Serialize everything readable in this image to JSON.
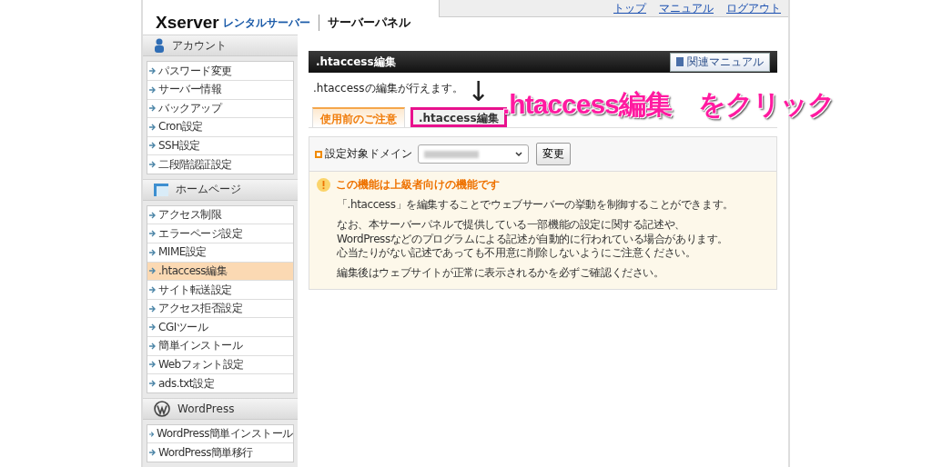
{
  "header": {
    "logo": {
      "brand": "Xserver",
      "product": "レンタルサーバー",
      "panel": "サーバーパネル"
    },
    "links": [
      "トップ",
      "マニュアル",
      "ログアウト"
    ]
  },
  "sidebar": {
    "sections": [
      {
        "title": "アカウント",
        "items": [
          {
            "label": "パスワード変更",
            "selected": false
          },
          {
            "label": "サーバー情報",
            "selected": false
          },
          {
            "label": "バックアップ",
            "selected": false
          },
          {
            "label": "Cron設定",
            "selected": false
          },
          {
            "label": "SSH設定",
            "selected": false
          },
          {
            "label": "二段階認証設定",
            "selected": false
          }
        ]
      },
      {
        "title": "ホームページ",
        "items": [
          {
            "label": "アクセス制限",
            "selected": false
          },
          {
            "label": "エラーページ設定",
            "selected": false
          },
          {
            "label": "MIME設定",
            "selected": false
          },
          {
            "label": ".htaccess編集",
            "selected": true
          },
          {
            "label": "サイト転送設定",
            "selected": false
          },
          {
            "label": "アクセス拒否設定",
            "selected": false
          },
          {
            "label": "CGIツール",
            "selected": false
          },
          {
            "label": "簡単インストール",
            "selected": false
          },
          {
            "label": "Webフォント設定",
            "selected": false
          },
          {
            "label": "ads.txt設定",
            "selected": false
          }
        ]
      },
      {
        "title": "WordPress",
        "items": [
          {
            "label": "WordPress簡単インストール",
            "selected": false
          },
          {
            "label": "WordPress簡単移行",
            "selected": false
          }
        ]
      }
    ]
  },
  "main": {
    "title": ".htaccess編集",
    "manual_button": "関連マニュアル",
    "description": ".htaccessの編集が行えます。",
    "tabs": [
      {
        "label": "使用前のご注意",
        "selected": true,
        "highlighted": false
      },
      {
        "label": ".htaccess編集",
        "selected": false,
        "highlighted": true
      }
    ],
    "domain": {
      "label": "設定対象ドメイン",
      "button": "変更"
    },
    "notice": {
      "title": "この機能は上級者向けの機能です",
      "paragraphs": [
        [
          "「.htaccess」を編集することでウェブサーバーの挙動を制御することができます。"
        ],
        [
          "なお、本サーバーパネルで提供している一部機能の設定に関する記述や、",
          "WordPressなどのプログラムによる記述が自動的に行われている場合があります。",
          "心当たりがない記述であっても不用意に削除しないようにご注意ください。"
        ],
        [
          "編集後はウェブサイトが正常に表示されるかを必ずご確認ください。"
        ]
      ]
    }
  },
  "annotation": {
    "arrow": "↓",
    "text": ".htaccess編集　をクリック"
  }
}
